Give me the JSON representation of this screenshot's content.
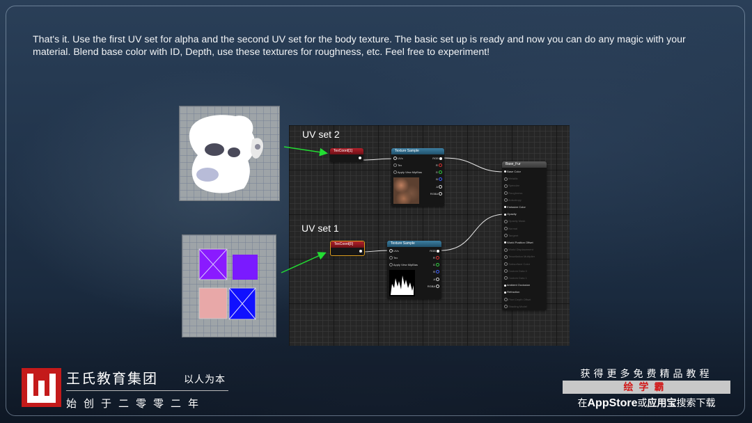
{
  "intro": "That's it. Use the first UV set for alpha and the second UV set for the body texture. The basic set up is ready and now you can do any magic with your material. Blend base color with ID, Depth, use these textures for roughness, etc. Feel free to experiment!",
  "labels": {
    "uv2": "UV set 2",
    "uv1": "UV set 1"
  },
  "nodes": {
    "texcoord1": {
      "title": "TexCoord[1]"
    },
    "texcoord0": {
      "title": "TexCoord[0]"
    },
    "texture_sample": {
      "title": "Texture Sample",
      "inputs": [
        "UVs",
        "Tex",
        "Apply View MipBias"
      ],
      "outputs": [
        "RGB",
        "R",
        "G",
        "B",
        "A",
        "RGBA"
      ]
    },
    "material": {
      "title": "Base_Fur",
      "pins": [
        {
          "label": "Base Color",
          "active": true
        },
        {
          "label": "Metallic",
          "active": false
        },
        {
          "label": "Specular",
          "active": false
        },
        {
          "label": "Roughness",
          "active": false
        },
        {
          "label": "Anisotropy",
          "active": false
        },
        {
          "label": "Emissive Color",
          "active": true
        },
        {
          "label": "Opacity",
          "active": true
        },
        {
          "label": "Opacity Mask",
          "active": false
        },
        {
          "label": "Normal",
          "active": false
        },
        {
          "label": "Tangent",
          "active": false
        },
        {
          "label": "World Position Offset",
          "active": true
        },
        {
          "label": "World Displacement",
          "active": false
        },
        {
          "label": "Tessellation Multiplier",
          "active": false
        },
        {
          "label": "Subsurface Color",
          "active": false
        },
        {
          "label": "Custom Data 0",
          "active": false
        },
        {
          "label": "Custom Data 1",
          "active": false
        },
        {
          "label": "Ambient Occlusion",
          "active": true
        },
        {
          "label": "Refraction",
          "active": true
        },
        {
          "label": "Pixel Depth Offset",
          "active": false
        },
        {
          "label": "Shading Model",
          "active": false
        }
      ]
    }
  },
  "brand": {
    "name": "王氏教育集团",
    "slogan": "以人为本",
    "founded": "始创于二零零二年"
  },
  "promo": {
    "top": "获得更多免费精品教程",
    "bar": "绘学霸",
    "bottom_pre": "在",
    "bottom_store": "AppStore",
    "bottom_mid": "或",
    "bottom_app": "应用宝",
    "bottom_post": "搜索下载"
  },
  "colors": {
    "logo_red": "#c41a1a",
    "arrow_green": "#22dd33",
    "texcoord_red": "#b0202a",
    "texture_blue": "#3d7fa2",
    "uv_purple": "#8a1aff",
    "uv_blue": "#1010ff",
    "uv_pink": "#e8a8a8"
  }
}
